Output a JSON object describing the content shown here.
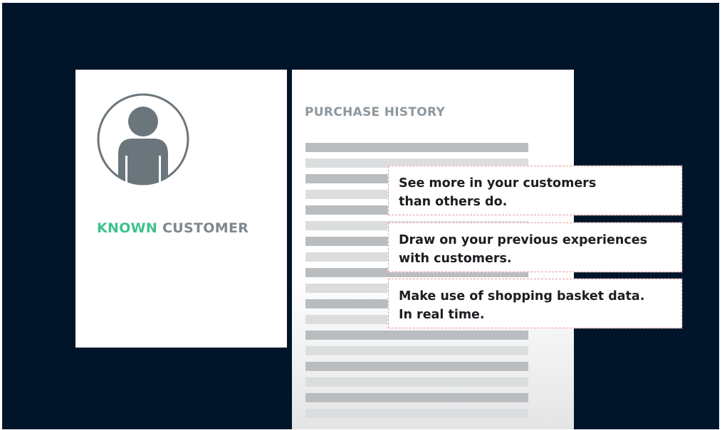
{
  "customer_card": {
    "label_highlight": "KNOWN",
    "label_rest": "CUSTOMER",
    "avatar_icon": "person-icon",
    "accent_color": "#3ec28f"
  },
  "history_card": {
    "title": "PURCHASE HISTORY"
  },
  "callouts": [
    {
      "line1": "See more in your customers",
      "line2": "than others do."
    },
    {
      "line1": "Draw on your previous experiences",
      "line2": "with customers."
    },
    {
      "line1": "Make use of shopping basket data.",
      "line2": "In real time."
    }
  ],
  "colors": {
    "background": "#00152a",
    "callout_border": "#e79a9f"
  }
}
